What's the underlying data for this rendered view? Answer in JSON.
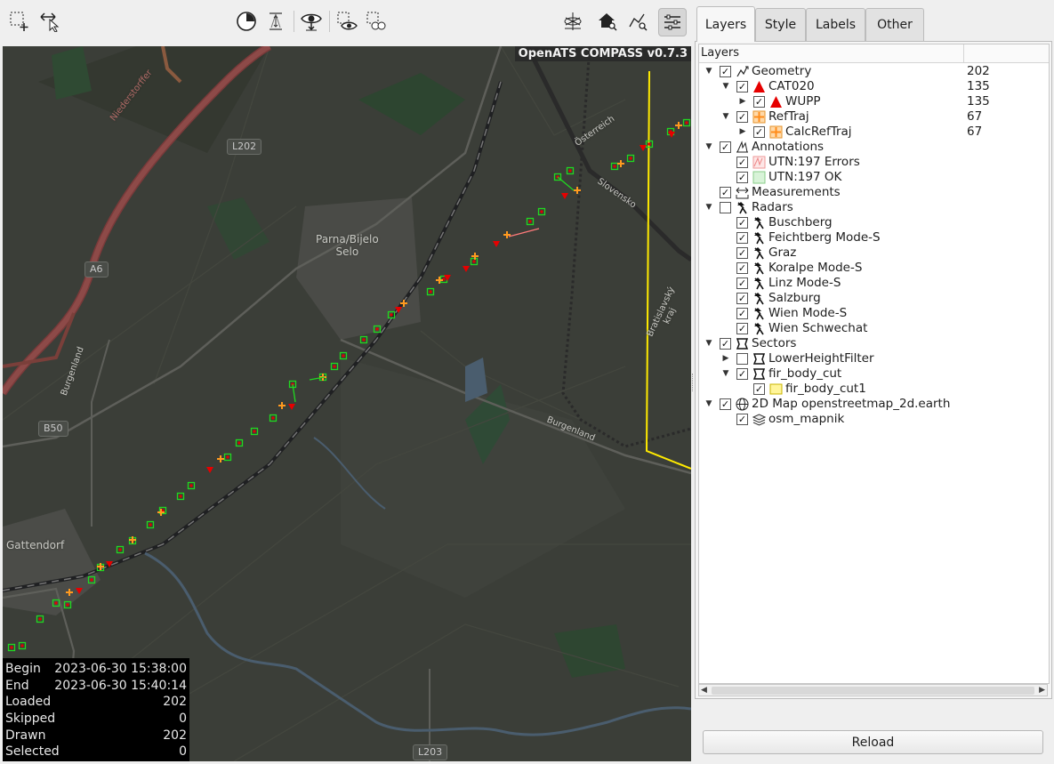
{
  "toolbar": {
    "left_tools": [
      {
        "name": "select-rect-icon"
      },
      {
        "name": "move-select-icon"
      }
    ],
    "center_tools": [
      {
        "name": "time-filter-icon"
      },
      {
        "name": "height-filter-icon"
      },
      {
        "name": "show-selected-icon"
      },
      {
        "name": "select-eye-icon"
      },
      {
        "name": "select-multi-icon"
      }
    ],
    "right_tools": [
      {
        "name": "globe-3d-icon"
      },
      {
        "name": "home-zoom-icon"
      },
      {
        "name": "route-zoom-icon"
      },
      {
        "name": "settings-sliders-icon",
        "active": true
      }
    ]
  },
  "map": {
    "watermark": "OpenATS COMPASS v0.7.3",
    "places": [
      {
        "name": "place-parna",
        "text": "Parna/Bijelo\nSelo"
      },
      {
        "name": "place-gattendorf",
        "text": "Gattendorf"
      }
    ],
    "roads": [
      "L202",
      "A6",
      "B50",
      "L203"
    ],
    "road_labels": [
      "Niederstorffer",
      "Burgenland",
      "Burgenland",
      "Österreich",
      "Slovensko",
      "Bratislavský kraj"
    ],
    "stats": [
      {
        "label": "Begin",
        "value": "2023-06-30 15:38:00"
      },
      {
        "label": "End",
        "value": "2023-06-30 15:40:14"
      },
      {
        "label": "Loaded",
        "value": "202"
      },
      {
        "label": "Skipped",
        "value": "0"
      },
      {
        "label": "Drawn",
        "value": "202"
      },
      {
        "label": "Selected",
        "value": "0"
      }
    ]
  },
  "tabs": [
    {
      "label": "Layers",
      "active": true
    },
    {
      "label": "Style"
    },
    {
      "label": "Labels"
    },
    {
      "label": "Other"
    }
  ],
  "tree": {
    "header": "Layers",
    "rows": [
      {
        "label": "Geometry",
        "count": "202",
        "level": 0,
        "expand": "open",
        "checked": true,
        "icon": "geometry-icon"
      },
      {
        "label": "CAT020",
        "count": "135",
        "level": 1,
        "expand": "open",
        "checked": true,
        "icon": "red-triangle-icon"
      },
      {
        "label": "WUPP",
        "count": "135",
        "level": 2,
        "expand": "closed",
        "checked": true,
        "icon": "red-triangle-icon"
      },
      {
        "label": "RefTraj",
        "count": "67",
        "level": 1,
        "expand": "open",
        "checked": true,
        "icon": "orange-cross-icon"
      },
      {
        "label": "CalcRefTraj",
        "count": "67",
        "level": 2,
        "expand": "closed",
        "checked": true,
        "icon": "orange-cross-icon"
      },
      {
        "label": "Annotations",
        "count": "",
        "level": 0,
        "expand": "open",
        "checked": true,
        "icon": "annotations-icon"
      },
      {
        "label": "UTN:197 Errors",
        "count": "",
        "level": 1,
        "expand": "none",
        "checked": true,
        "icon": "errors-swatch-icon"
      },
      {
        "label": "UTN:197 OK",
        "count": "",
        "level": 1,
        "expand": "none",
        "checked": true,
        "icon": "ok-swatch-icon"
      },
      {
        "label": "Measurements",
        "count": "",
        "level": 0,
        "expand": "none",
        "checked": true,
        "icon": "measure-icon"
      },
      {
        "label": "Radars",
        "count": "",
        "level": 0,
        "expand": "open",
        "checked": false,
        "icon": "radar-icon"
      },
      {
        "label": "Buschberg",
        "count": "",
        "level": 1,
        "expand": "none",
        "checked": true,
        "icon": "radar-icon"
      },
      {
        "label": "Feichtberg Mode-S",
        "count": "",
        "level": 1,
        "expand": "none",
        "checked": true,
        "icon": "radar-icon"
      },
      {
        "label": "Graz",
        "count": "",
        "level": 1,
        "expand": "none",
        "checked": true,
        "icon": "radar-icon"
      },
      {
        "label": "Koralpe Mode-S",
        "count": "",
        "level": 1,
        "expand": "none",
        "checked": true,
        "icon": "radar-icon"
      },
      {
        "label": "Linz Mode-S",
        "count": "",
        "level": 1,
        "expand": "none",
        "checked": true,
        "icon": "radar-icon"
      },
      {
        "label": "Salzburg",
        "count": "",
        "level": 1,
        "expand": "none",
        "checked": true,
        "icon": "radar-icon"
      },
      {
        "label": "Wien Mode-S",
        "count": "",
        "level": 1,
        "expand": "none",
        "checked": true,
        "icon": "radar-icon"
      },
      {
        "label": "Wien Schwechat",
        "count": "",
        "level": 1,
        "expand": "none",
        "checked": true,
        "icon": "radar-icon"
      },
      {
        "label": "Sectors",
        "count": "",
        "level": 0,
        "expand": "open",
        "checked": true,
        "icon": "sector-icon"
      },
      {
        "label": "LowerHeightFilter",
        "count": "",
        "level": 1,
        "expand": "closed",
        "checked": false,
        "icon": "sector-icon"
      },
      {
        "label": "fir_body_cut",
        "count": "",
        "level": 1,
        "expand": "open",
        "checked": true,
        "icon": "sector-icon"
      },
      {
        "label": "fir_body_cut1",
        "count": "",
        "level": 2,
        "expand": "none",
        "checked": true,
        "icon": "yellow-folder-icon"
      },
      {
        "label": "2D Map openstreetmap_2d.earth",
        "count": "",
        "level": 0,
        "expand": "open",
        "checked": true,
        "icon": "globe-icon"
      },
      {
        "label": "osm_mapnik",
        "count": "",
        "level": 1,
        "expand": "none",
        "checked": true,
        "icon": "layers-stack-icon"
      }
    ]
  },
  "reload_label": "Reload",
  "colors": {
    "target_report": "#e60000",
    "ref_traj": "#ff9a1f",
    "ok_box": "#21d821",
    "sector_border": "#ffea00"
  }
}
